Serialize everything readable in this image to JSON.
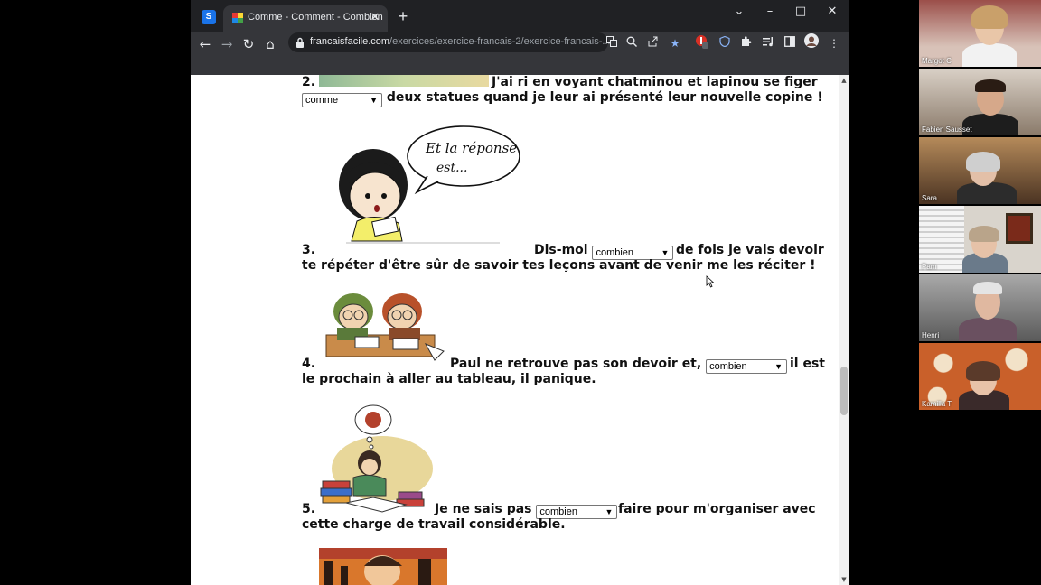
{
  "browser": {
    "profile_letter": "S",
    "tab": {
      "title": "Comme - Comment - Combien",
      "close": "✕"
    },
    "new_tab": "+",
    "window_controls": {
      "tabsearch": "⌄",
      "minimize": "–",
      "maximize": "□",
      "close": "✕"
    },
    "nav": {
      "back": "←",
      "forward": "→",
      "reload": "↻",
      "home": "⌂"
    },
    "url": {
      "host": "francaisfacile.com",
      "path": "/exercices/exercice-francais-2/exercice-francais-..."
    },
    "extension_badge": "2",
    "menu": "⋮"
  },
  "exercise": {
    "q2": {
      "number": "2.",
      "text_before": "J'ai ri en voyant chatminou et lapinou se figer",
      "select_value": "comme",
      "text_after": "deux statues quand je leur ai présenté leur nouvelle copine !"
    },
    "q3": {
      "number": "3.",
      "text_before": "Dis-moi",
      "select_value": "combien",
      "text_after": "de fois je vais devoir te répéter d'être sûr de savoir tes leçons avant de venir me les réciter !",
      "bubble_line1": "Et la réponse",
      "bubble_line2": "est..."
    },
    "q4": {
      "number": "4.",
      "text_before": "Paul ne retrouve pas son devoir et,",
      "select_value": "combien",
      "text_after": "il est le prochain à aller au tableau, il panique."
    },
    "q5": {
      "number": "5.",
      "text_before": "Je ne sais pas",
      "select_value": "combien",
      "text_after": "faire pour m'organiser avec cette charge de travail considérable."
    }
  },
  "participants": [
    {
      "name": "Margot C"
    },
    {
      "name": "Fabien Sausset"
    },
    {
      "name": "Sara"
    },
    {
      "name": "Pam"
    },
    {
      "name": "Henri"
    },
    {
      "name": "Kamilla T"
    }
  ]
}
